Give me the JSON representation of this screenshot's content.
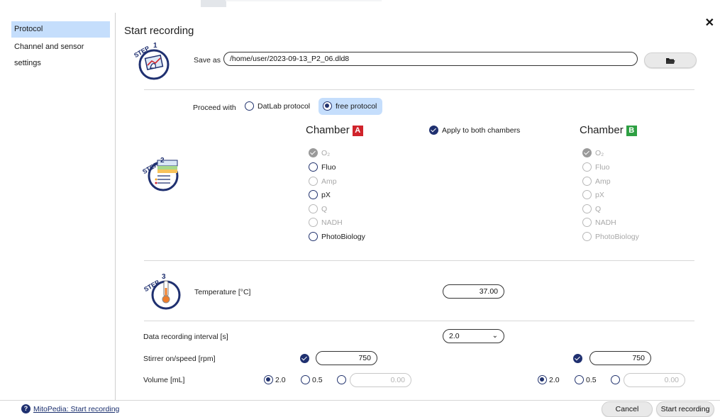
{
  "sidebar": {
    "items": [
      {
        "label": "Protocol"
      },
      {
        "label": "Channel and sensor settings"
      }
    ]
  },
  "title": "Start recording",
  "step1": {
    "save_as_label": "Save as",
    "path_value": "/home/user/2023-09-13_P2_06.dld8",
    "folder_icon": "folder-open-icon"
  },
  "proceed": {
    "label": "Proceed with",
    "option_datlab": "DatLab protocol",
    "option_free": "free protocol",
    "selected": "free protocol"
  },
  "chambers": {
    "a_title": "Chamber",
    "a_badge": "A",
    "a_color": "#d0232b",
    "b_title": "Chamber",
    "b_badge": "B",
    "b_color": "#2ea043",
    "apply_both": "Apply to both chambers",
    "channels_a": [
      {
        "label": "O₂",
        "state": "checked-disabled"
      },
      {
        "label": "Fluo",
        "state": "enabled"
      },
      {
        "label": "Amp",
        "state": "disabled"
      },
      {
        "label": "pX",
        "state": "enabled"
      },
      {
        "label": "Q",
        "state": "disabled"
      },
      {
        "label": "NADH",
        "state": "disabled"
      },
      {
        "label": "PhotoBiology",
        "state": "enabled"
      }
    ],
    "channels_b": [
      {
        "label": "O₂",
        "state": "checked-disabled"
      },
      {
        "label": "Fluo",
        "state": "disabled"
      },
      {
        "label": "Amp",
        "state": "disabled"
      },
      {
        "label": "pX",
        "state": "disabled"
      },
      {
        "label": "Q",
        "state": "disabled"
      },
      {
        "label": "NADH",
        "state": "disabled"
      },
      {
        "label": "PhotoBiology",
        "state": "disabled"
      }
    ]
  },
  "step3": {
    "temperature_label": "Temperature [°C]",
    "temperature_value": "37.00"
  },
  "settings": {
    "interval_label": "Data recording interval [s]",
    "interval_value": "2.0",
    "stirrer_label": "Stirrer on/speed [rpm]",
    "stirrer_a": "750",
    "stirrer_b": "750",
    "volume_label": "Volume [mL]",
    "volume_opt1": "2.0",
    "volume_opt2": "0.5",
    "volume_custom_a": "0.00",
    "volume_custom_b": "0.00"
  },
  "footer": {
    "help_link": "MitoPedia: Start recording",
    "cancel": "Cancel",
    "start": "Start recording"
  },
  "colors": {
    "accent": "#1f3070",
    "sidebar_active": "#c5defc",
    "proceed_selected_bg": "#c5defc"
  }
}
